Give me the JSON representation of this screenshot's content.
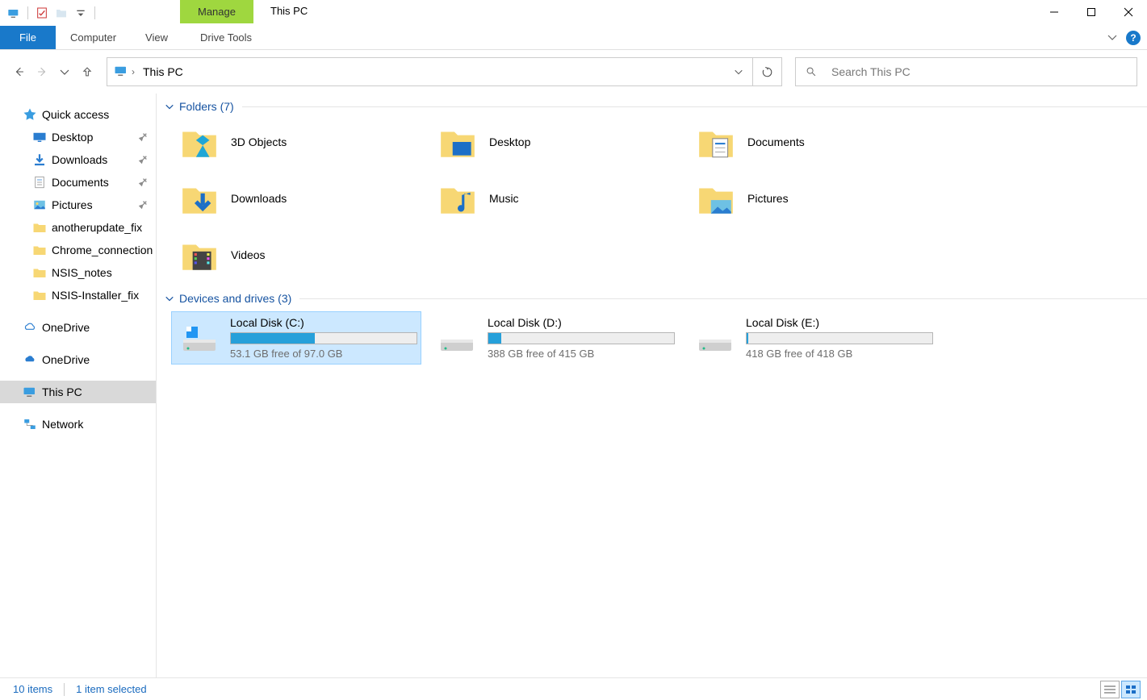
{
  "window": {
    "title": "This PC",
    "context_tab": "Manage",
    "context_subtab": "Drive Tools"
  },
  "ribbon_tabs": {
    "file": "File",
    "computer": "Computer",
    "view": "View"
  },
  "address": {
    "location": "This PC"
  },
  "search": {
    "placeholder": "Search This PC"
  },
  "sidebar": {
    "quick_access": "Quick access",
    "desktop": "Desktop",
    "downloads": "Downloads",
    "documents": "Documents",
    "pictures": "Pictures",
    "anotherupdate": "anotherupdate_fix",
    "chrome_conn": "Chrome_connection",
    "nsis_notes": "NSIS_notes",
    "nsis_installer": "NSIS-Installer_fix",
    "onedrive1": "OneDrive",
    "onedrive2": "OneDrive",
    "this_pc": "This PC",
    "network": "Network"
  },
  "groups": {
    "folders_header": "Folders (7)",
    "drives_header": "Devices and drives (3)"
  },
  "folders": {
    "0": "3D Objects",
    "1": "Desktop",
    "2": "Documents",
    "3": "Downloads",
    "4": "Music",
    "5": "Pictures",
    "6": "Videos"
  },
  "drives": {
    "0": {
      "name": "Local Disk (C:)",
      "free": "53.1 GB free of 97.0 GB",
      "pct": 45
    },
    "1": {
      "name": "Local Disk (D:)",
      "free": "388 GB free of 415 GB",
      "pct": 7
    },
    "2": {
      "name": "Local Disk (E:)",
      "free": "418 GB free of 418 GB",
      "pct": 1
    }
  },
  "status": {
    "count": "10 items",
    "selected": "1 item selected"
  }
}
